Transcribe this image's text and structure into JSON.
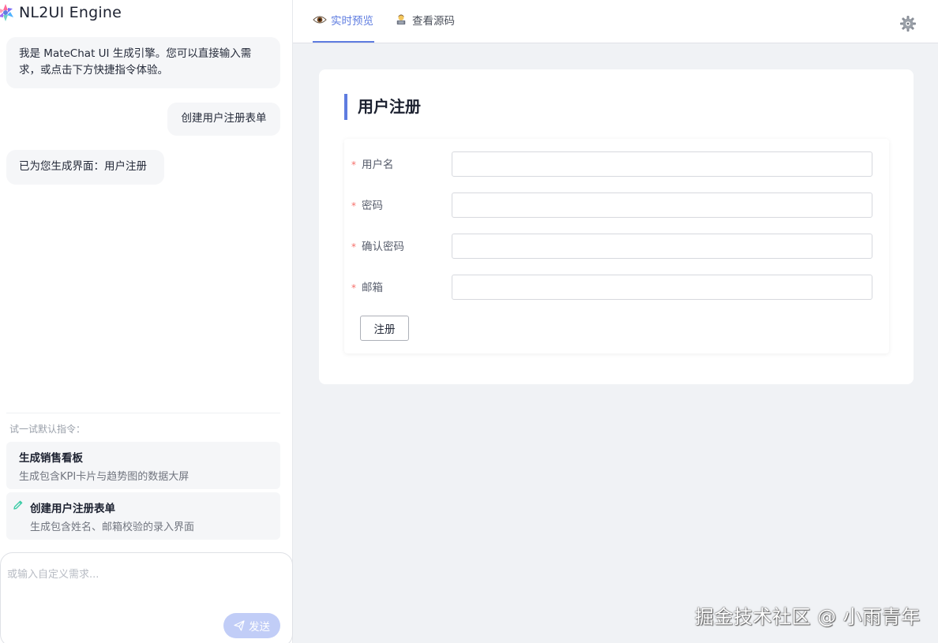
{
  "app": {
    "title": "NL2UI Engine"
  },
  "chat": {
    "messages": [
      {
        "role": "assistant",
        "text": "我是 MateChat UI 生成引擎。您可以直接输入需求，或点击下方快捷指令体验。"
      },
      {
        "role": "user",
        "text": "创建用户注册表单"
      },
      {
        "role": "assistant",
        "text": "已为您生成界面：用户注册"
      }
    ],
    "try_label": "试一试默认指令：",
    "suggestions": [
      {
        "title": "生成销售看板",
        "desc": "生成包含KPI卡片与趋势图的数据大屏"
      },
      {
        "title": "创建用户注册表单",
        "desc": "生成包含姓名、邮箱校验的录入界面"
      }
    ],
    "input": {
      "placeholder": "或输入自定义需求...",
      "value": ""
    },
    "send_label": "发送"
  },
  "tabs": [
    {
      "label": "实时预览",
      "icon": "eye-icon",
      "active": true
    },
    {
      "label": "查看源码",
      "icon": "technologist-icon",
      "active": false
    }
  ],
  "preview": {
    "form_title": "用户注册",
    "fields": [
      {
        "label": "用户名",
        "required": true,
        "value": ""
      },
      {
        "label": "密码",
        "required": true,
        "value": ""
      },
      {
        "label": "确认密码",
        "required": true,
        "value": ""
      },
      {
        "label": "邮箱",
        "required": true,
        "value": ""
      }
    ],
    "required_mark": "*",
    "submit_label": "注册"
  },
  "watermark": "掘金技术社区 @ 小雨青年",
  "colors": {
    "accent": "#5e7ce0",
    "send_button": "#c1cdf7",
    "required": "#f66f6a",
    "panel_bg": "#f0f2f5"
  }
}
